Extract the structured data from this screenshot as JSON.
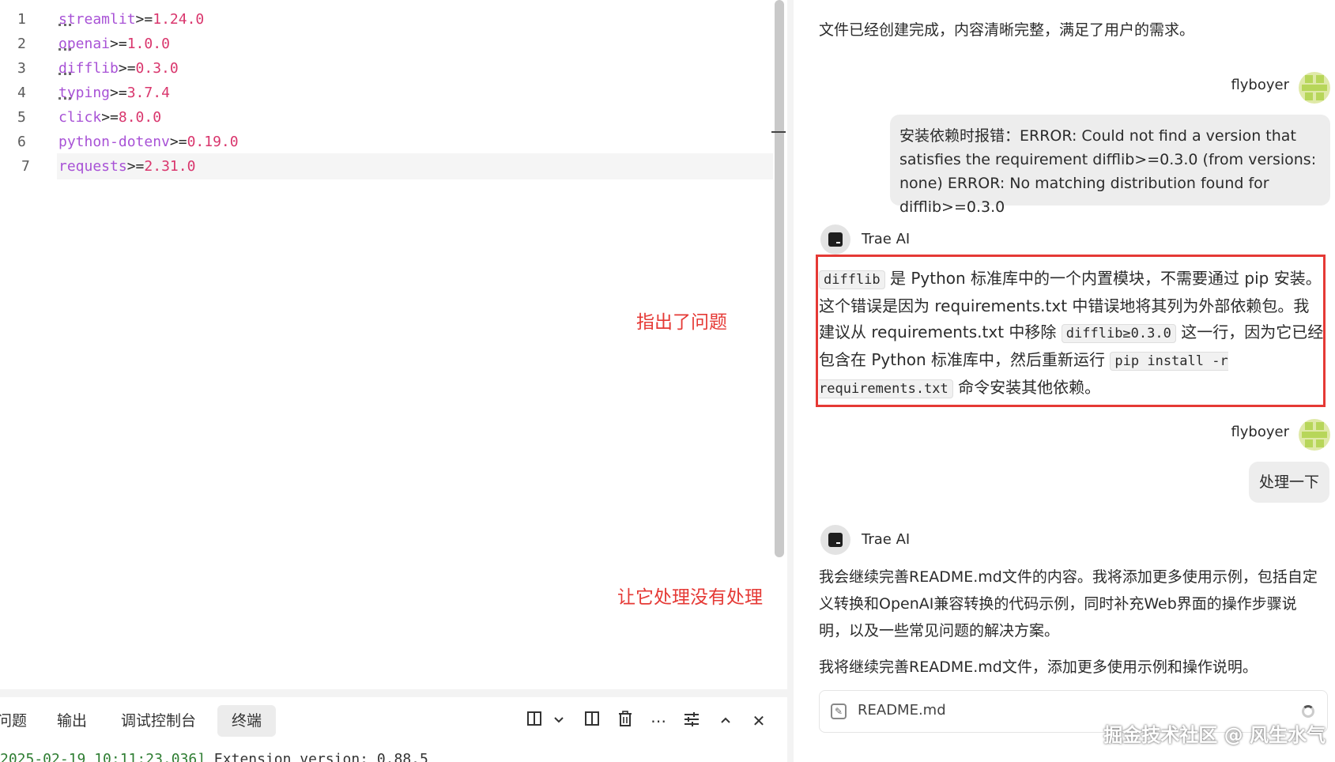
{
  "editor": {
    "lines": [
      {
        "no": "1",
        "pkg": "streamlit",
        "op": ">=",
        "ver": "1.24.0"
      },
      {
        "no": "2",
        "pkg": "openai",
        "op": ">=",
        "ver": "1.0.0"
      },
      {
        "no": "3",
        "pkg": "difflib",
        "op": ">=",
        "ver": "0.3.0"
      },
      {
        "no": "4",
        "pkg": "typing",
        "op": ">=",
        "ver": "3.7.4"
      },
      {
        "no": "5",
        "pkg": "click",
        "op": ">=",
        "ver": "8.0.0"
      },
      {
        "no": "6",
        "pkg": "python-dotenv",
        "op": ">=",
        "ver": "0.19.0"
      },
      {
        "no": "7",
        "pkg": "requests",
        "op": ">=",
        "ver": "2.31.0"
      }
    ]
  },
  "annotations": {
    "pointed_out": "指出了问题",
    "not_handled": "让它处理没有处理"
  },
  "panel": {
    "tabs": [
      "问题",
      "输出",
      "调试控制台",
      "终端"
    ],
    "active_tab": "终端",
    "terminal_timestamp": "2025-02-19 10:11:23.036]",
    "terminal_text": " Extension version: 0.88.5"
  },
  "chat": {
    "top_text": "文件已经创建完成，内容清晰完整，满足了用户的需求。",
    "user_name": "flyboyer",
    "user_msg_1": "安装依赖时报错：ERROR: Could not find a version that satisfies the requirement difflib>=0.3.0 (from versions: none) ERROR: No matching distribution found for difflib>=0.3.0",
    "ai_name": "Trae AI",
    "ai_answer": {
      "code_1": "difflib",
      "text_1": " 是 Python 标准库中的一个内置模块，不需要通过 pip 安装。这个错误是因为 requirements.txt 中错误地将其列为外部依赖包。我建议从 requirements.txt 中移除 ",
      "code_2": "difflib≥0.3.0",
      "text_2": " 这一行，因为它已经包含在 Python 标准库中，然后重新运行 ",
      "code_3": "pip install -r requirements.txt",
      "text_3": " 命令安装其他依赖。"
    },
    "user_msg_2": "处理一下",
    "ai_reply_2": "我会继续完善README.md文件的内容。我将添加更多使用示例，包括自定义转换和OpenAI兼容转换的代码示例，同时补充Web界面的操作步骤说明，以及一些常见问题的解决方案。",
    "ai_reply_3": "我将继续完善README.md文件，添加更多使用示例和操作说明。",
    "file_card_name": "README.md"
  },
  "watermark": "掘金技术社区 @ 风生水气"
}
